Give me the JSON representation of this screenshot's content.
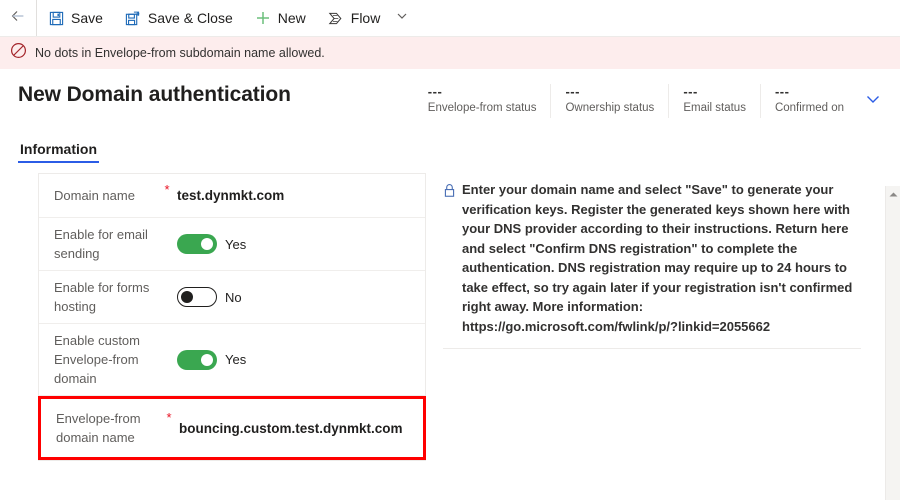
{
  "commandbar": {
    "back_icon": "arrow-left-icon",
    "items": [
      {
        "label": "Save",
        "icon": "save-icon"
      },
      {
        "label": "Save & Close",
        "icon": "save-and-close-icon"
      },
      {
        "label": "New",
        "icon": "plus-icon"
      },
      {
        "label": "Flow",
        "icon": "flow-icon"
      }
    ],
    "overflow_icon": "chevron-down-icon"
  },
  "error_banner": {
    "icon": "blocked-icon",
    "message": "No dots in Envelope-from subdomain name allowed."
  },
  "header": {
    "title": "New Domain authentication",
    "expand_icon": "chevron-down-icon",
    "statuses": [
      {
        "value": "---",
        "label": "Envelope-from status"
      },
      {
        "value": "---",
        "label": "Ownership status"
      },
      {
        "value": "---",
        "label": "Email status"
      },
      {
        "value": "---",
        "label": "Confirmed on"
      }
    ]
  },
  "tabs": [
    {
      "label": "Information",
      "active": true
    }
  ],
  "form": {
    "rows": [
      {
        "label": "Domain name",
        "required": "*",
        "type": "text",
        "value": "test.dynmkt.com",
        "highlighted": false
      },
      {
        "label": "Enable for email sending",
        "required": "",
        "type": "toggle",
        "toggle_state": "on",
        "value": "Yes",
        "highlighted": false
      },
      {
        "label": "Enable for forms hosting",
        "required": "",
        "type": "toggle",
        "toggle_state": "off",
        "value": "No",
        "highlighted": false
      },
      {
        "label": "Enable custom Envelope-from domain",
        "required": "",
        "type": "toggle",
        "toggle_state": "on",
        "value": "Yes",
        "highlighted": false
      },
      {
        "label": "Envelope-from domain name",
        "required": "*",
        "type": "text",
        "value": "bouncing.custom.test.dynmkt.com",
        "highlighted": true
      }
    ]
  },
  "help": {
    "icon": "lock-icon",
    "text": "Enter your domain name and select \"Save\" to generate your verification keys. Register the generated keys shown here with your DNS provider according to their instructions. Return here and select \"Confirm DNS registration\" to complete the authentication. DNS registration may require up to 24 hours to take effect, so try again later if your registration isn't confirmed right away. More information: https://go.microsoft.com/fwlink/p/?linkid=2055662"
  },
  "scrollbar": {
    "up_icon": "scroll-up-arrow-icon"
  },
  "colors": {
    "accent": "#2b5ce6",
    "toggle_on": "#3aa750",
    "required": "#e81123",
    "highlight": "#ff0000",
    "error_bg": "#fdeded"
  }
}
